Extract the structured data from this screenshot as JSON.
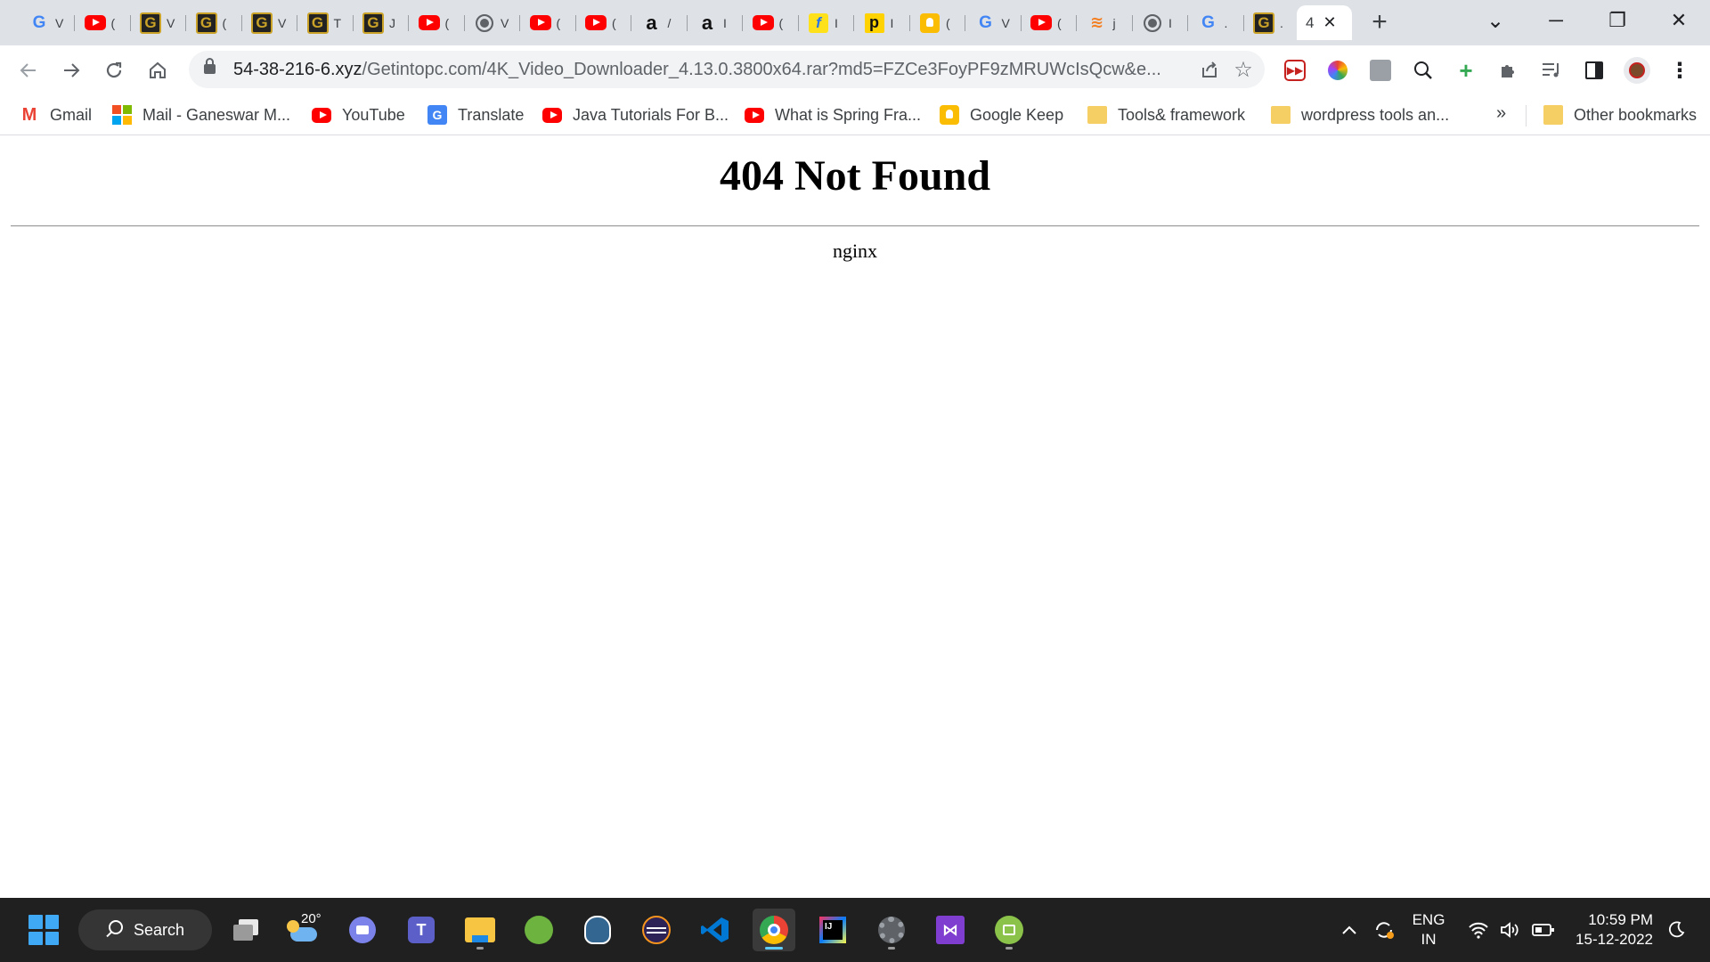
{
  "browser": {
    "tabs": [
      {
        "icon": "google-icon",
        "label": "V"
      },
      {
        "icon": "youtube-icon",
        "label": "("
      },
      {
        "icon": "getintopc-icon",
        "label": "V"
      },
      {
        "icon": "getintopc-icon",
        "label": "("
      },
      {
        "icon": "getintopc-icon",
        "label": "V"
      },
      {
        "icon": "getintopc-icon",
        "label": "T"
      },
      {
        "icon": "getintopc-icon",
        "label": "J"
      },
      {
        "icon": "youtube-icon",
        "label": "("
      },
      {
        "icon": "globe-icon",
        "label": "V"
      },
      {
        "icon": "youtube-icon",
        "label": "("
      },
      {
        "icon": "youtube-icon",
        "label": "("
      },
      {
        "icon": "amazon-icon",
        "label": "/"
      },
      {
        "icon": "amazon-icon",
        "label": "I"
      },
      {
        "icon": "youtube-icon",
        "label": "("
      },
      {
        "icon": "flipkart-icon",
        "label": "I"
      },
      {
        "icon": "p-icon",
        "label": "I"
      },
      {
        "icon": "keep-icon",
        "label": "("
      },
      {
        "icon": "google-icon",
        "label": "V"
      },
      {
        "icon": "youtube-icon",
        "label": "("
      },
      {
        "icon": "stackoverflow-icon",
        "label": "j"
      },
      {
        "icon": "globe-icon",
        "label": "I"
      },
      {
        "icon": "google-icon",
        "label": "."
      },
      {
        "icon": "getintopc-icon",
        "label": "."
      }
    ],
    "active_tab": {
      "label": "4",
      "close": "✕"
    },
    "new_tab": "+",
    "window_controls": {
      "tab_search": "⌄",
      "minimize": "─",
      "restore": "❐",
      "close": "✕"
    },
    "address": {
      "host": "54-38-216-6.xyz",
      "path": "/Getintopc.com/4K_Video_Downloader_4.13.0.3800x64.rar?md5=FZCe3FoyPF9zMRUWcIsQcw&e..."
    },
    "bookmarks": [
      {
        "icon": "gmail-icon",
        "label": "Gmail"
      },
      {
        "icon": "microsoft-icon",
        "label": "Mail - Ganeswar M..."
      },
      {
        "icon": "youtube-icon",
        "label": "YouTube"
      },
      {
        "icon": "translate-icon",
        "label": "Translate"
      },
      {
        "icon": "youtube-icon",
        "label": "Java Tutorials For B..."
      },
      {
        "icon": "youtube-icon",
        "label": "What is Spring Fra..."
      },
      {
        "icon": "keep-icon",
        "label": "Google Keep"
      },
      {
        "icon": "folder-icon",
        "label": "Tools& framework"
      },
      {
        "icon": "folder-icon",
        "label": "wordpress tools an..."
      }
    ],
    "bookmarks_overflow": "»",
    "other_bookmarks": "Other bookmarks"
  },
  "page": {
    "title": "404 Not Found",
    "server": "nginx"
  },
  "taskbar": {
    "search_label": "Search",
    "weather_temp": "20°",
    "lang_line1": "ENG",
    "lang_line2": "IN",
    "time": "10:59 PM",
    "date": "15-12-2022"
  },
  "colors": {
    "tabstrip": "#dee1e6",
    "taskbar": "#202020",
    "accent": "#60cdff"
  }
}
